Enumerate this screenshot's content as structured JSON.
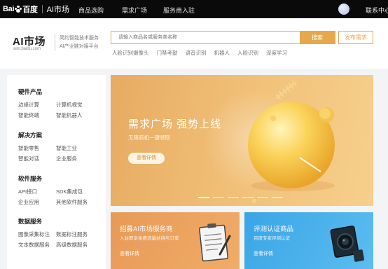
{
  "topbar": {
    "logo_text_left": "Bai",
    "logo_text_right": "百度",
    "product": "AI市场",
    "nav": [
      "商品选购",
      "需求广场",
      "服务商入驻"
    ],
    "user": "联系中心"
  },
  "header": {
    "logo": "AI市场",
    "url": "aim.baidu.com",
    "tagline_1": "简约智能技术服务",
    "tagline_2": "AI产业链对接平台",
    "search_placeholder": "请输入商品名或服务商名称",
    "search_button": "搜索",
    "publish_button": "发布需求",
    "hot_tags": [
      "人脸识别摄像头",
      "门禁考勤",
      "语音识别",
      "机器人",
      "人脸识别",
      "深度学习"
    ]
  },
  "sidebar": {
    "categories": [
      {
        "title": "硬件产品",
        "items": [
          "边缘计算",
          "计算机视觉",
          "智能终端",
          "智能机器人"
        ]
      },
      {
        "title": "解决方案",
        "items": [
          "智能零售",
          "智能工业",
          "智能对话",
          "企业服务"
        ]
      },
      {
        "title": "软件服务",
        "items": [
          "API接口",
          "SDK集成包",
          "企业应用",
          "其他软件服务"
        ]
      },
      {
        "title": "数据服务",
        "items": [
          "图像采集标注",
          "数据标注服务",
          "文本数据服务",
          "高级数据服务"
        ]
      }
    ]
  },
  "banner": {
    "title": "需求广场 强势上线",
    "subtitle": "无限商机一键领取",
    "button": "查看详情",
    "slide_count": 6,
    "active_slide": 1
  },
  "promo_cards": [
    {
      "title": "招募AI市场服务商",
      "subtitle": "入驻即享免费流量扶持与订单",
      "link": "查看详情",
      "icon": "clipboard-icon"
    },
    {
      "title": "评测认证商品",
      "subtitle": "百度专家评测认证",
      "link": "查看详情",
      "icon": "camera-icon"
    }
  ],
  "colors": {
    "accent": "#e6a84a",
    "topbar_bg": "#0a0a0a",
    "banner_orange": "#e7ab62",
    "card_blue": "#3aa5e6"
  }
}
